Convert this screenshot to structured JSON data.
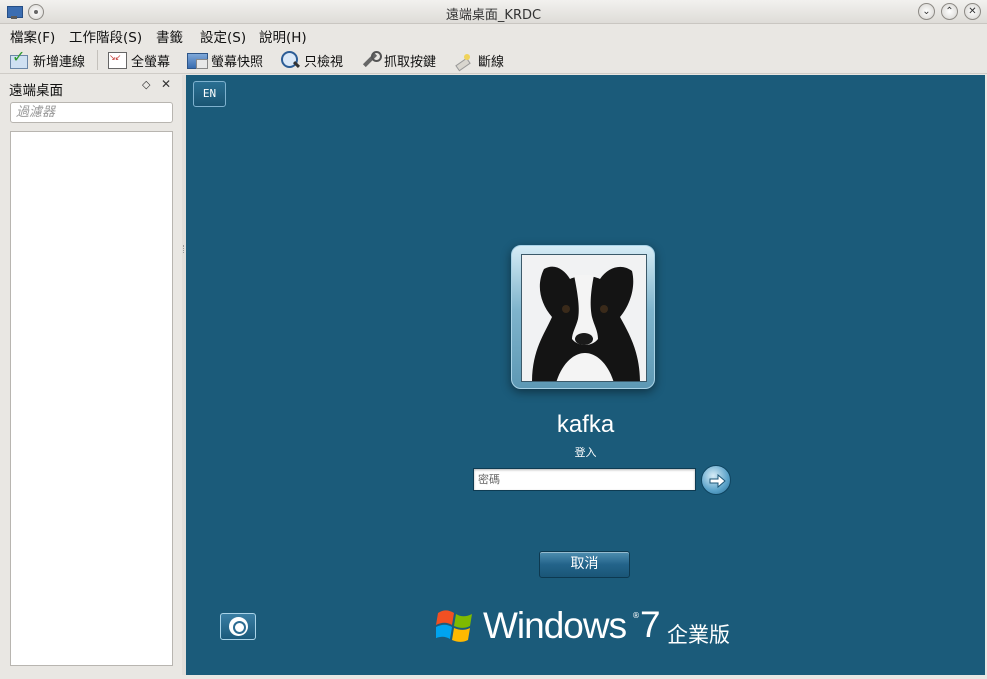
{
  "window": {
    "title": "遠端桌面_KRDC",
    "minimize_glyph": "⌄",
    "maximize_glyph": "⌃",
    "close_glyph": "✕"
  },
  "menu": {
    "items": [
      "檔案(F)",
      "工作階段(S)",
      "書籤",
      "設定(S)",
      "說明(H)"
    ]
  },
  "toolbar": {
    "new_connection": "新增連線",
    "fullscreen": "全螢幕",
    "screenshot": "螢幕快照",
    "view_only": "只檢視",
    "grab_keys": "抓取按鍵",
    "disconnect": "斷線"
  },
  "dock": {
    "title": "遠端桌面",
    "float_glyph": "◇",
    "close_glyph": "✕",
    "filter_placeholder": "過濾器"
  },
  "remote": {
    "language": "EN",
    "username": "kafka",
    "status": "登入",
    "password_placeholder": "密碼",
    "cancel_label": "取消",
    "brand_name": "Windows",
    "brand_version": "7",
    "brand_edition": "企業版",
    "colors": {
      "background": "#1b5b7a",
      "button": "#23638a"
    }
  }
}
